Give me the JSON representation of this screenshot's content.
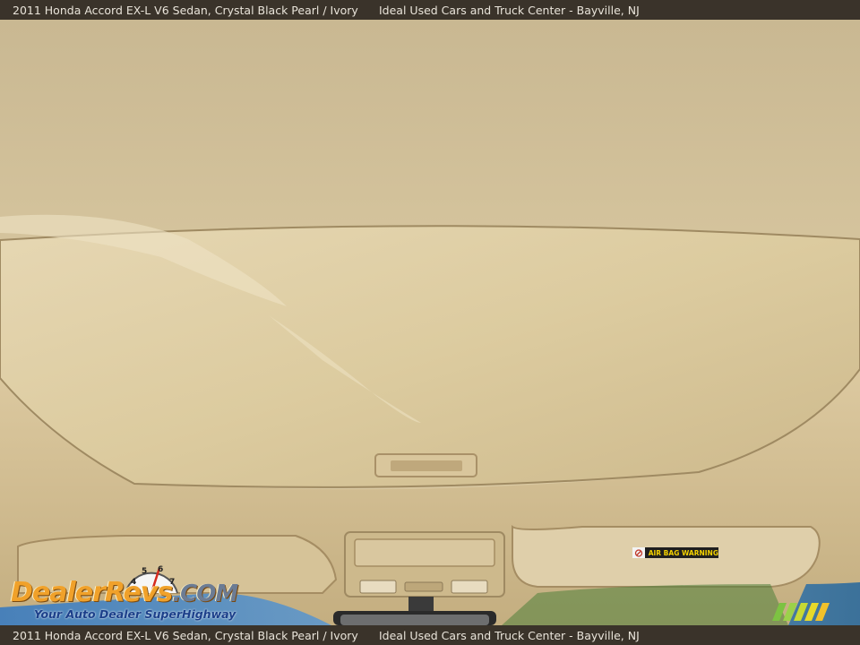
{
  "caption": {
    "vehicle": "2011 Honda Accord EX-L V6 Sedan,  Crystal Black Pearl / Ivory",
    "dealer": "Ideal Used Cars and Truck Center - Bayville, NJ"
  },
  "photo": {
    "airbag_label": "AIR BAG WARNING"
  },
  "watermark": {
    "brand_main": "DealerRevs",
    "brand_suffix": ".COM",
    "tagline": "Your Auto Dealer SuperHighway",
    "gauge_numbers": [
      "4",
      "5",
      "6",
      "7"
    ]
  },
  "colors": {
    "headliner": "#d8c7a0",
    "bar": "#3a332a",
    "logo_orange": "#f0a12a",
    "logo_blue": "#1b3f8a"
  }
}
